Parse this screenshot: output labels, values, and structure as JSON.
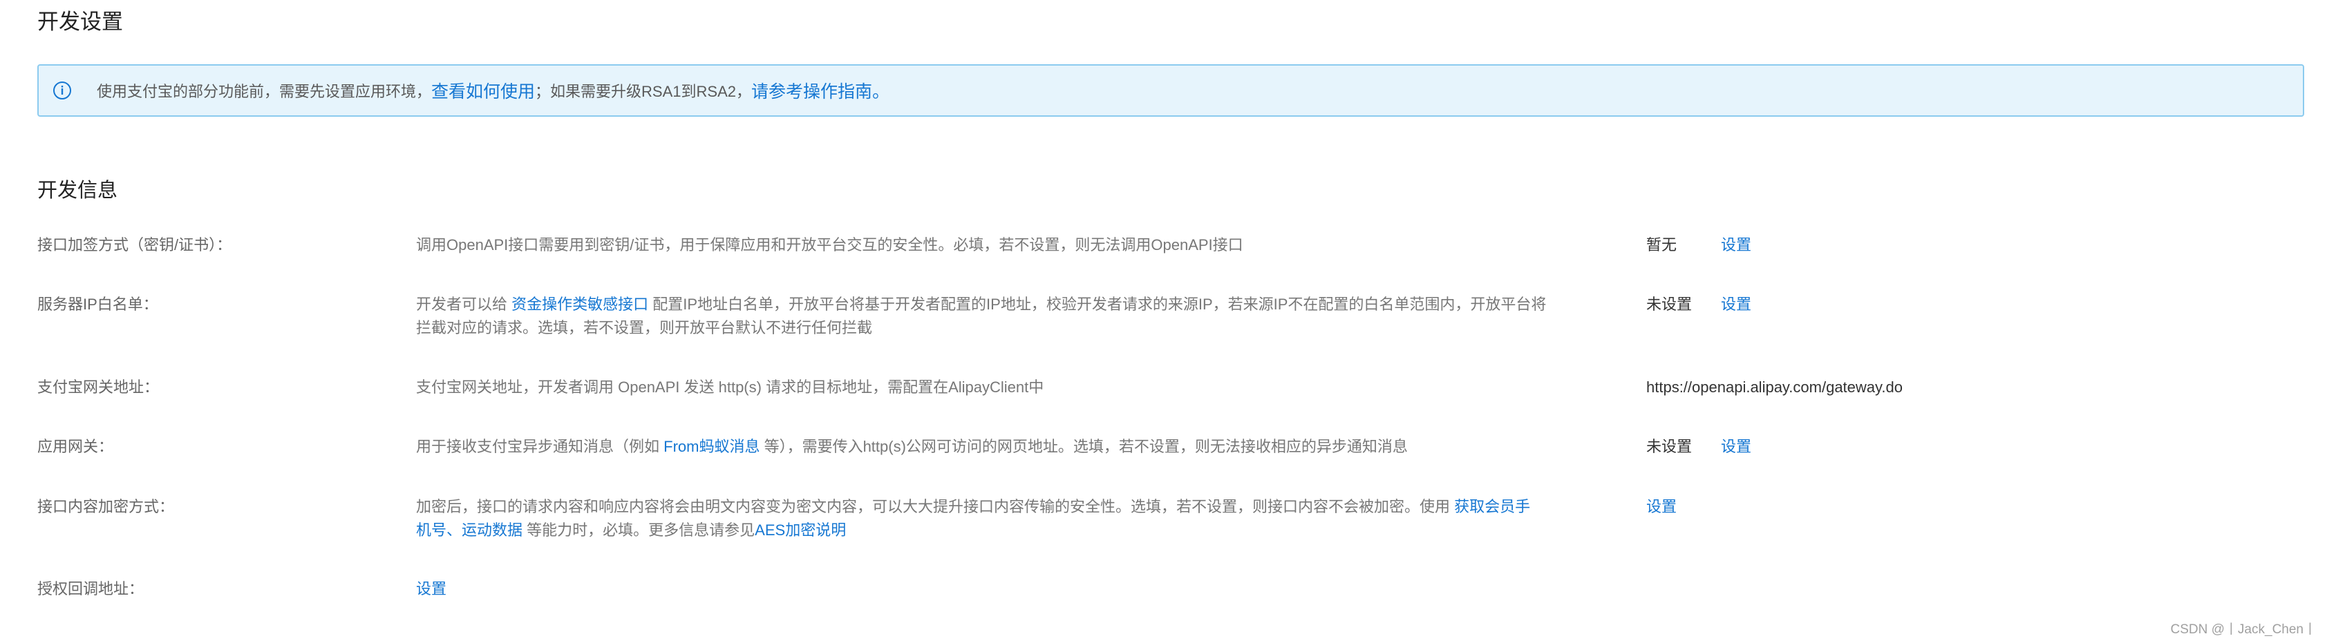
{
  "page": {
    "title": "开发设置"
  },
  "notice": {
    "text_before": "使用支付宝的部分功能前，需要先设置应用环境，",
    "link_how_to": "查看如何使用",
    "text_middle": "；如果需要升级RSA1到RSA2，",
    "link_guide": "请参考操作指南。"
  },
  "section": {
    "title": "开发信息"
  },
  "rows": {
    "signing": {
      "label": "接口加签方式（密钥/证书）：",
      "desc": "调用OpenAPI接口需要用到密钥/证书，用于保障应用和开放平台交互的安全性。必填，若不设置，则无法调用OpenAPI接口",
      "status": "暂无",
      "action": "设置"
    },
    "ip_whitelist": {
      "label": "服务器IP白名单：",
      "desc_before": "开发者可以给 ",
      "desc_link": "资金操作类敏感接口",
      "desc_after": " 配置IP地址白名单，开放平台将基于开发者配置的IP地址，校验开发者请求的来源IP，若来源IP不在配置的白名单范围内，开放平台将拦截对应的请求。选填，若不设置，则开放平台默认不进行任何拦截",
      "status": "未设置",
      "action": "设置"
    },
    "gateway": {
      "label": "支付宝网关地址：",
      "desc": "支付宝网关地址，开发者调用 OpenAPI 发送 http(s) 请求的目标地址，需配置在AlipayClient中",
      "value": "https://openapi.alipay.com/gateway.do"
    },
    "app_gateway": {
      "label": "应用网关：",
      "desc_before": "用于接收支付宝异步通知消息（例如 ",
      "desc_link": "From蚂蚁消息",
      "desc_after": " 等），需要传入http(s)公网可访问的网页地址。选填，若不设置，则无法接收相应的异步通知消息",
      "status": "未设置",
      "action": "设置"
    },
    "encryption": {
      "label": "接口内容加密方式：",
      "desc_before": "加密后，接口的请求内容和响应内容将会由明文内容变为密文内容，可以大大提升接口内容传输的安全性。选填，若不设置，则接口内容不会被加密。使用 ",
      "desc_link1": "获取会员手机号",
      "desc_sep": "、",
      "desc_link2": "运动数据",
      "desc_middle": " 等能力时，必填。更多信息请参见",
      "desc_link3": "AES加密说明",
      "action": "设置"
    },
    "auth_callback": {
      "label": "授权回调地址：",
      "action": "设置"
    }
  },
  "watermark": "CSDN @丨Jack_Chen丨",
  "colors": {
    "link": "#1677d2",
    "notice_bg": "#e6f4fc",
    "notice_border": "#8ccbef"
  },
  "icons": {
    "notice_icon": "info-circle-icon"
  }
}
